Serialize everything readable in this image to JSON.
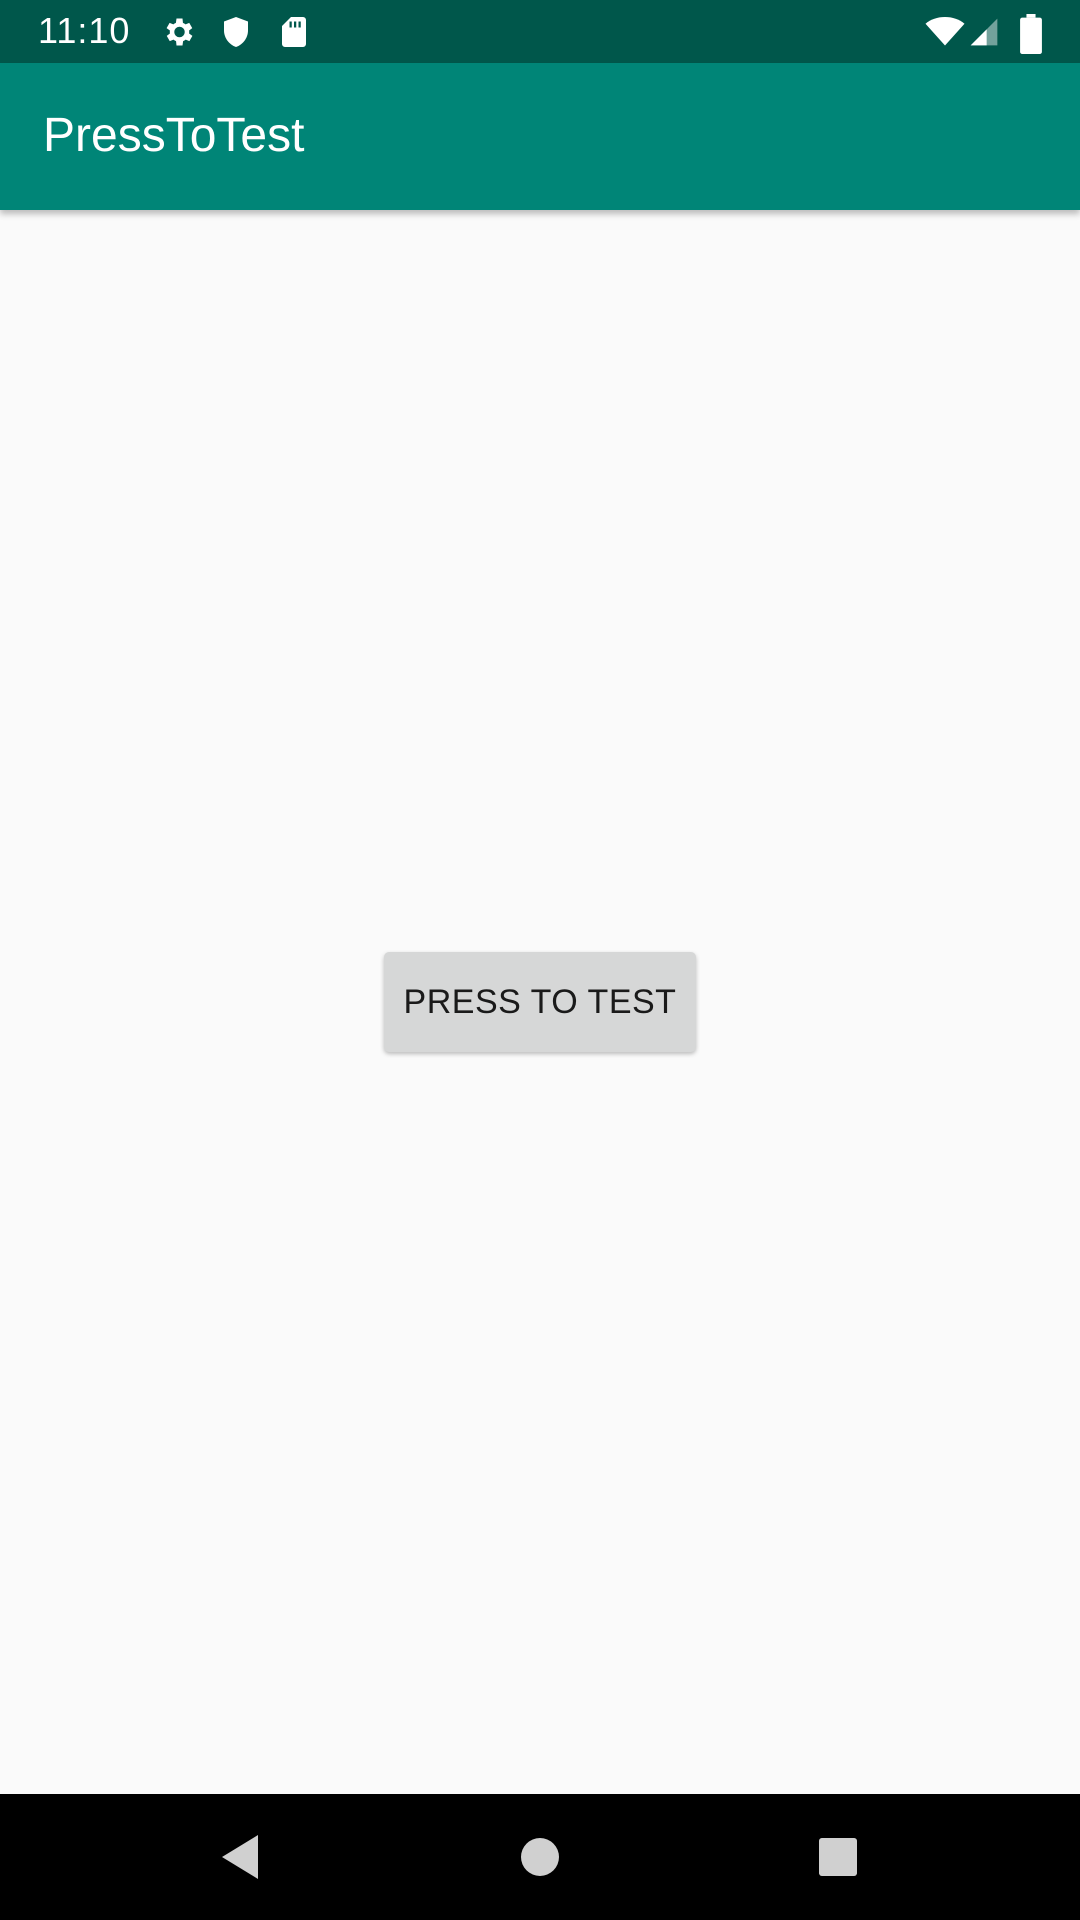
{
  "status_bar": {
    "time": "11:10",
    "icons": [
      "gear-icon",
      "shield-icon",
      "sd-card-icon",
      "wifi-icon",
      "signal-icon",
      "battery-icon"
    ],
    "background": "#00574b"
  },
  "app_bar": {
    "title": "PressToTest",
    "background": "#008577"
  },
  "main": {
    "button_label": "PRESS TO TEST"
  },
  "nav_bar": {
    "buttons": [
      "back-icon",
      "home-icon",
      "recents-icon"
    ]
  }
}
